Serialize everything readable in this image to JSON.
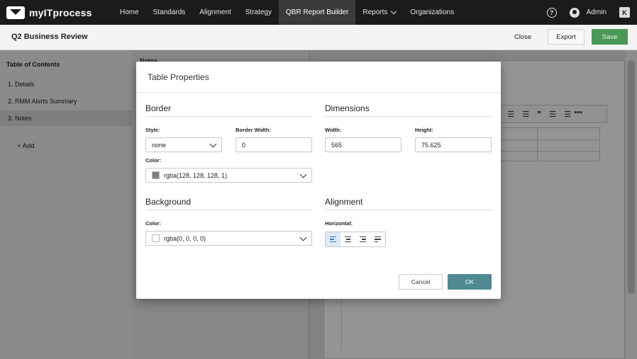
{
  "nav": {
    "logo_text": "myITprocess",
    "items": [
      {
        "label": "Home"
      },
      {
        "label": "Standards"
      },
      {
        "label": "Alignment"
      },
      {
        "label": "Strategy"
      },
      {
        "label": "QBR Report Builder"
      },
      {
        "label": "Reports"
      },
      {
        "label": "Organizations"
      }
    ],
    "help_glyph": "?",
    "user_label": "Admin",
    "app_badge": "K"
  },
  "subheader": {
    "title": "Q2 Business Review",
    "close_label": "Close",
    "export_label": "Export",
    "save_label": "Save"
  },
  "sidebar": {
    "title": "Table of Contents",
    "items": [
      {
        "label": "1. Details"
      },
      {
        "label": "2. RMM Alerts Summary"
      },
      {
        "label": "3. Notes"
      }
    ],
    "add_label": "+ Add"
  },
  "mid_panel": {
    "label": "Notes"
  },
  "editor": {
    "toolbar_glyphs": "☰ ☰ ❞ ☰ ☰",
    "toolbar_more": "•••"
  },
  "modal": {
    "title": "Table Properties",
    "border": {
      "title": "Border",
      "style_label": "Style:",
      "style_value": "none",
      "width_label": "Border Width:",
      "width_value": "0",
      "color_label": "Color:",
      "color_value": "rgba(128, 128, 128, 1)",
      "color_swatch": "#808080"
    },
    "dimensions": {
      "title": "Dimensions",
      "width_label": "Width:",
      "width_value": "565",
      "height_label": "Height:",
      "height_value": "75.625"
    },
    "background": {
      "title": "Background",
      "color_label": "Color:",
      "color_value": "rgba(0, 0, 0, 0)",
      "color_swatch": "#ffffff"
    },
    "alignment": {
      "title": "Alignment",
      "horizontal_label": "Horizontal:",
      "options": [
        "align-left-icon",
        "align-center-icon",
        "align-right-icon",
        "align-justify-icon"
      ],
      "selected": "align-left-icon"
    },
    "cancel_label": "Cancel",
    "ok_label": "OK"
  },
  "colors": {
    "nav_bg": "#1b1b1b",
    "save_green": "#4a9a57",
    "ok_teal": "#4f8a90",
    "align_active": "#3d74c7"
  }
}
